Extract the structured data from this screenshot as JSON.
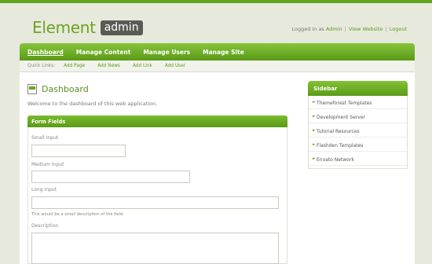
{
  "header": {
    "logo_text": "Element",
    "logo_badge": "admin",
    "logged_in_prefix": "Logged in as ",
    "user_name": "Admin",
    "view_website": "View Website",
    "logout": "Logout",
    "separator": "|"
  },
  "nav": {
    "items": [
      {
        "label": "Dashboard"
      },
      {
        "label": "Manage Content"
      },
      {
        "label": "Manage Users"
      },
      {
        "label": "Manage Site"
      }
    ]
  },
  "subnav": {
    "label": "Quick Links:",
    "links": [
      {
        "label": "Add Page"
      },
      {
        "label": "Add News"
      },
      {
        "label": "Add Link"
      },
      {
        "label": "Add User"
      }
    ]
  },
  "main": {
    "title": "Dashboard",
    "welcome": "Welcome to the dashboard of this web application.",
    "panel_title": "Form Fields",
    "fields": {
      "small_label": "Small Input",
      "small_value": "",
      "medium_label": "Medium Input",
      "medium_value": "",
      "long_label": "Long Input",
      "long_value": "",
      "long_help": "This would be a small description of the field.",
      "description_label": "Description"
    }
  },
  "sidebar": {
    "title": "Sidebar",
    "items": [
      {
        "label": "Themeforest Templates"
      },
      {
        "label": "Development Server"
      },
      {
        "label": "Tutorial Resources"
      },
      {
        "label": "Flashden Templates"
      },
      {
        "label": "Envato Network"
      }
    ]
  },
  "colors": {
    "accent": "#62a51a",
    "background": "#e7e9dc"
  }
}
